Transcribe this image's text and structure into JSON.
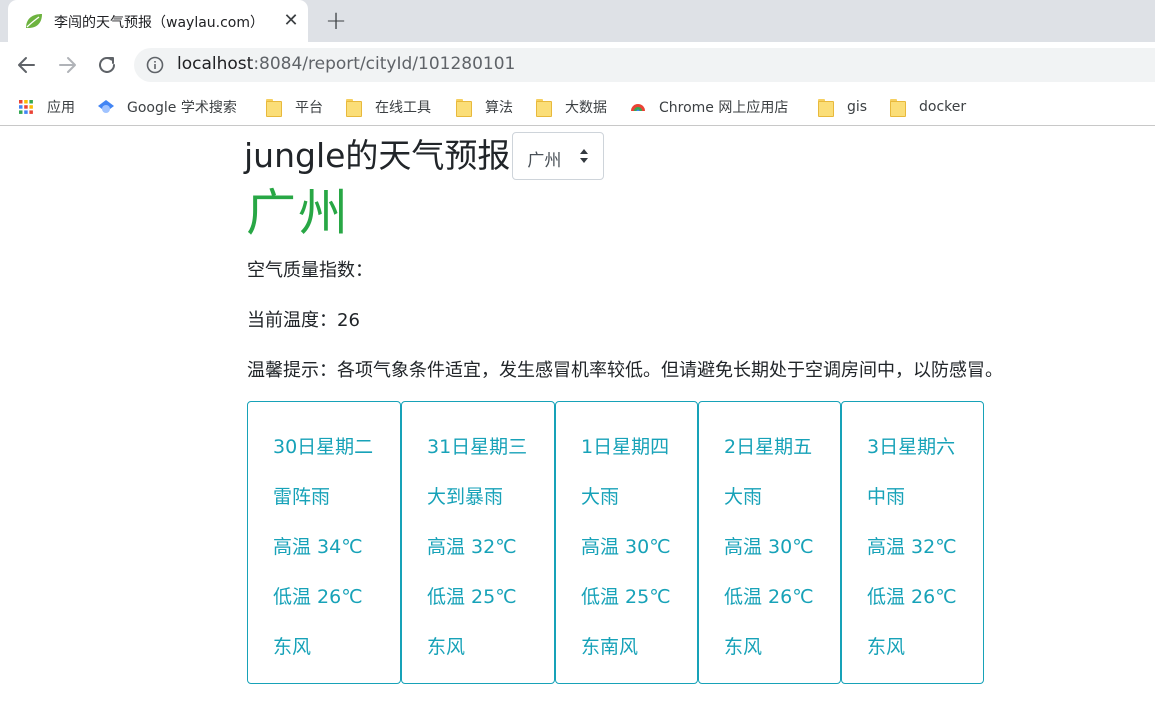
{
  "browser": {
    "tab_title": "李闯的天气预报（waylau.com）",
    "url_host": "localhost",
    "url_path": ":8084/report/cityId/101280101",
    "bookmarks": [
      {
        "label": "应用",
        "icon": "apps-grid-icon"
      },
      {
        "label": "Google 学术搜索",
        "icon": "scholar-icon"
      },
      {
        "label": "平台",
        "icon": "folder-icon"
      },
      {
        "label": "在线工具",
        "icon": "folder-icon"
      },
      {
        "label": "算法",
        "icon": "folder-icon"
      },
      {
        "label": "大数据",
        "icon": "folder-icon"
      },
      {
        "label": "Chrome 网上应用店",
        "icon": "webstore-icon"
      },
      {
        "label": "gis",
        "icon": "folder-icon"
      },
      {
        "label": "docker",
        "icon": "folder-icon"
      }
    ]
  },
  "page": {
    "title": "jungle的天气预报",
    "city_select_value": "广州",
    "city": "广州",
    "aqi_text": "空气质量指数：",
    "temp_text": "当前温度：26",
    "tip_text": "温馨提示：各项气象条件适宜，发生感冒机率较低。但请避免长期处于空调房间中，以防感冒。"
  },
  "forecast": [
    {
      "day": "30日星期二",
      "type": "雷阵雨",
      "high": "高温 34℃",
      "low": "低温 26℃",
      "wind": "东风"
    },
    {
      "day": "31日星期三",
      "type": "大到暴雨",
      "high": "高温 32℃",
      "low": "低温 25℃",
      "wind": "东风"
    },
    {
      "day": "1日星期四",
      "type": "大雨",
      "high": "高温 30℃",
      "low": "低温 25℃",
      "wind": "东南风"
    },
    {
      "day": "2日星期五",
      "type": "大雨",
      "high": "高温 30℃",
      "low": "低温 26℃",
      "wind": "东风"
    },
    {
      "day": "3日星期六",
      "type": "中雨",
      "high": "高温 32℃",
      "low": "低温 26℃",
      "wind": "东风"
    }
  ],
  "colors": {
    "city": "#28a745",
    "card_accent": "#17a2b8",
    "tabstrip": "#dee1e6"
  }
}
